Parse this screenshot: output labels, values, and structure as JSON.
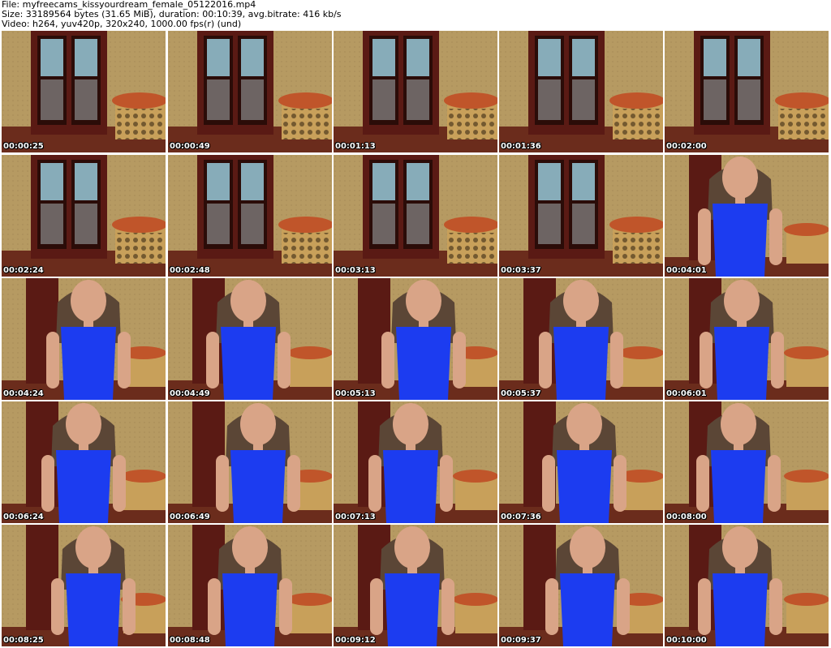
{
  "header": {
    "file_line": "File: myfreecams_kissyourdream_female_05122016.mp4",
    "size_line": "Size: 33189564 bytes (31.65 MiB), duration: 00:10:39, avg.bitrate: 416 kb/s",
    "video_line": "Video: h264, yuv420p, 320x240, 1000.00 fps(r) (und)"
  },
  "thumbnails": [
    {
      "time": "00:00:25",
      "scene": "room"
    },
    {
      "time": "00:00:49",
      "scene": "room"
    },
    {
      "time": "00:01:13",
      "scene": "room"
    },
    {
      "time": "00:01:36",
      "scene": "room"
    },
    {
      "time": "00:02:00",
      "scene": "room"
    },
    {
      "time": "00:02:24",
      "scene": "room"
    },
    {
      "time": "00:02:48",
      "scene": "room"
    },
    {
      "time": "00:03:13",
      "scene": "room"
    },
    {
      "time": "00:03:37",
      "scene": "room"
    },
    {
      "time": "00:04:01",
      "scene": "person"
    },
    {
      "time": "00:04:24",
      "scene": "person"
    },
    {
      "time": "00:04:49",
      "scene": "person"
    },
    {
      "time": "00:05:13",
      "scene": "person"
    },
    {
      "time": "00:05:37",
      "scene": "person"
    },
    {
      "time": "00:06:01",
      "scene": "person"
    },
    {
      "time": "00:06:24",
      "scene": "person"
    },
    {
      "time": "00:06:49",
      "scene": "person"
    },
    {
      "time": "00:07:13",
      "scene": "person"
    },
    {
      "time": "00:07:36",
      "scene": "person"
    },
    {
      "time": "00:08:00",
      "scene": "person"
    },
    {
      "time": "00:08:25",
      "scene": "person"
    },
    {
      "time": "00:08:48",
      "scene": "person"
    },
    {
      "time": "00:09:12",
      "scene": "person"
    },
    {
      "time": "00:09:37",
      "scene": "person"
    },
    {
      "time": "00:10:00",
      "scene": "person"
    }
  ],
  "colors": {
    "wall": "#b69a62",
    "cabinet": "#5a1a14",
    "glass": "#9fd4e6",
    "sofa": "#c8a05a",
    "dress": "#1c3cf0",
    "skin": "#d9a487",
    "hair": "#5b4636",
    "floor": "#6b2c1c"
  }
}
